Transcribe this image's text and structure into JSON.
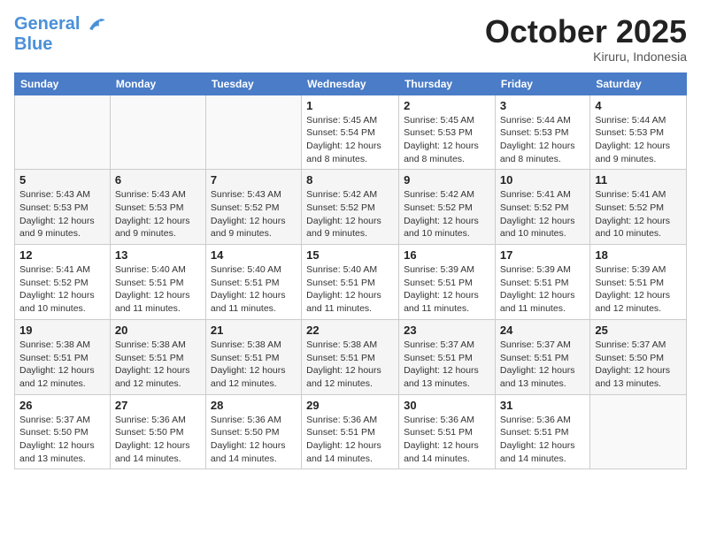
{
  "header": {
    "logo_line1": "General",
    "logo_line2": "Blue",
    "month": "October 2025",
    "location": "Kiruru, Indonesia"
  },
  "weekdays": [
    "Sunday",
    "Monday",
    "Tuesday",
    "Wednesday",
    "Thursday",
    "Friday",
    "Saturday"
  ],
  "weeks": [
    [
      {
        "day": "",
        "info": ""
      },
      {
        "day": "",
        "info": ""
      },
      {
        "day": "",
        "info": ""
      },
      {
        "day": "1",
        "info": "Sunrise: 5:45 AM\nSunset: 5:54 PM\nDaylight: 12 hours and 8 minutes."
      },
      {
        "day": "2",
        "info": "Sunrise: 5:45 AM\nSunset: 5:53 PM\nDaylight: 12 hours and 8 minutes."
      },
      {
        "day": "3",
        "info": "Sunrise: 5:44 AM\nSunset: 5:53 PM\nDaylight: 12 hours and 8 minutes."
      },
      {
        "day": "4",
        "info": "Sunrise: 5:44 AM\nSunset: 5:53 PM\nDaylight: 12 hours and 9 minutes."
      }
    ],
    [
      {
        "day": "5",
        "info": "Sunrise: 5:43 AM\nSunset: 5:53 PM\nDaylight: 12 hours and 9 minutes."
      },
      {
        "day": "6",
        "info": "Sunrise: 5:43 AM\nSunset: 5:53 PM\nDaylight: 12 hours and 9 minutes."
      },
      {
        "day": "7",
        "info": "Sunrise: 5:43 AM\nSunset: 5:52 PM\nDaylight: 12 hours and 9 minutes."
      },
      {
        "day": "8",
        "info": "Sunrise: 5:42 AM\nSunset: 5:52 PM\nDaylight: 12 hours and 9 minutes."
      },
      {
        "day": "9",
        "info": "Sunrise: 5:42 AM\nSunset: 5:52 PM\nDaylight: 12 hours and 10 minutes."
      },
      {
        "day": "10",
        "info": "Sunrise: 5:41 AM\nSunset: 5:52 PM\nDaylight: 12 hours and 10 minutes."
      },
      {
        "day": "11",
        "info": "Sunrise: 5:41 AM\nSunset: 5:52 PM\nDaylight: 12 hours and 10 minutes."
      }
    ],
    [
      {
        "day": "12",
        "info": "Sunrise: 5:41 AM\nSunset: 5:52 PM\nDaylight: 12 hours and 10 minutes."
      },
      {
        "day": "13",
        "info": "Sunrise: 5:40 AM\nSunset: 5:51 PM\nDaylight: 12 hours and 11 minutes."
      },
      {
        "day": "14",
        "info": "Sunrise: 5:40 AM\nSunset: 5:51 PM\nDaylight: 12 hours and 11 minutes."
      },
      {
        "day": "15",
        "info": "Sunrise: 5:40 AM\nSunset: 5:51 PM\nDaylight: 12 hours and 11 minutes."
      },
      {
        "day": "16",
        "info": "Sunrise: 5:39 AM\nSunset: 5:51 PM\nDaylight: 12 hours and 11 minutes."
      },
      {
        "day": "17",
        "info": "Sunrise: 5:39 AM\nSunset: 5:51 PM\nDaylight: 12 hours and 11 minutes."
      },
      {
        "day": "18",
        "info": "Sunrise: 5:39 AM\nSunset: 5:51 PM\nDaylight: 12 hours and 12 minutes."
      }
    ],
    [
      {
        "day": "19",
        "info": "Sunrise: 5:38 AM\nSunset: 5:51 PM\nDaylight: 12 hours and 12 minutes."
      },
      {
        "day": "20",
        "info": "Sunrise: 5:38 AM\nSunset: 5:51 PM\nDaylight: 12 hours and 12 minutes."
      },
      {
        "day": "21",
        "info": "Sunrise: 5:38 AM\nSunset: 5:51 PM\nDaylight: 12 hours and 12 minutes."
      },
      {
        "day": "22",
        "info": "Sunrise: 5:38 AM\nSunset: 5:51 PM\nDaylight: 12 hours and 12 minutes."
      },
      {
        "day": "23",
        "info": "Sunrise: 5:37 AM\nSunset: 5:51 PM\nDaylight: 12 hours and 13 minutes."
      },
      {
        "day": "24",
        "info": "Sunrise: 5:37 AM\nSunset: 5:51 PM\nDaylight: 12 hours and 13 minutes."
      },
      {
        "day": "25",
        "info": "Sunrise: 5:37 AM\nSunset: 5:50 PM\nDaylight: 12 hours and 13 minutes."
      }
    ],
    [
      {
        "day": "26",
        "info": "Sunrise: 5:37 AM\nSunset: 5:50 PM\nDaylight: 12 hours and 13 minutes."
      },
      {
        "day": "27",
        "info": "Sunrise: 5:36 AM\nSunset: 5:50 PM\nDaylight: 12 hours and 14 minutes."
      },
      {
        "day": "28",
        "info": "Sunrise: 5:36 AM\nSunset: 5:50 PM\nDaylight: 12 hours and 14 minutes."
      },
      {
        "day": "29",
        "info": "Sunrise: 5:36 AM\nSunset: 5:51 PM\nDaylight: 12 hours and 14 minutes."
      },
      {
        "day": "30",
        "info": "Sunrise: 5:36 AM\nSunset: 5:51 PM\nDaylight: 12 hours and 14 minutes."
      },
      {
        "day": "31",
        "info": "Sunrise: 5:36 AM\nSunset: 5:51 PM\nDaylight: 12 hours and 14 minutes."
      },
      {
        "day": "",
        "info": ""
      }
    ]
  ]
}
